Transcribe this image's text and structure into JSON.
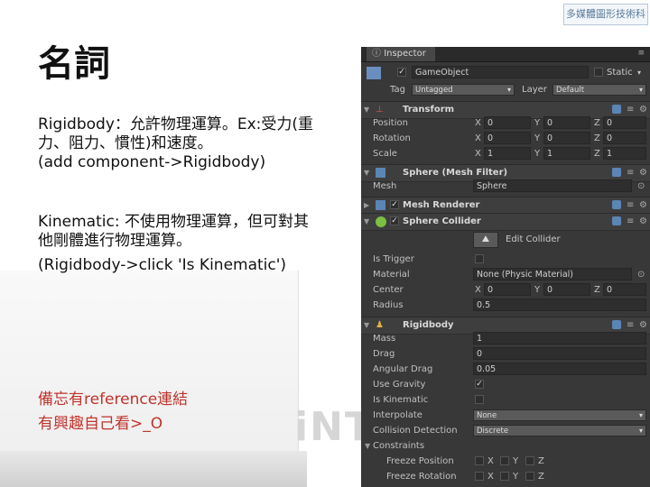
{
  "slide": {
    "title": "名詞",
    "para1_line1": "Rigidbody：允許物理運算。Ex:受力(重",
    "para1_line2": "力、阻力、慣性)和速度。",
    "para1_line3": "(add component->Rigidbody)",
    "para2_line1": "Kinematic: 不使用物理運算，但可對其",
    "para2_line2": "他剛體進行物理運算。",
    "para2_line3": "(Rigidbody->click 'Is Kinematic')",
    "note_line1": "備忘有reference連結",
    "note_line2": "有興趣自己看>_O",
    "logo_text": "多媒體圖形技術科",
    "watermark": "iNT"
  },
  "inspector": {
    "tab_label": "Inspector",
    "gameobject_name": "GameObject",
    "static_label": "Static",
    "tag_label": "Tag",
    "tag_value": "Untagged",
    "layer_label": "Layer",
    "layer_value": "Default",
    "transform": {
      "title": "Transform",
      "position_label": "Position",
      "rotation_label": "Rotation",
      "scale_label": "Scale",
      "x": "X",
      "y": "Y",
      "z": "Z",
      "position": [
        "0",
        "0",
        "0"
      ],
      "rotation": [
        "0",
        "0",
        "0"
      ],
      "scale": [
        "1",
        "1",
        "1"
      ]
    },
    "mesh_filter": {
      "title": "Sphere (Mesh Filter)",
      "mesh_label": "Mesh",
      "mesh_value": "Sphere"
    },
    "mesh_renderer": {
      "title": "Mesh Renderer"
    },
    "sphere_collider": {
      "title": "Sphere Collider",
      "edit_label": "Edit Collider",
      "is_trigger_label": "Is Trigger",
      "material_label": "Material",
      "material_value": "None (Physic Material)",
      "center_label": "Center",
      "center": [
        "0",
        "0",
        "0"
      ],
      "radius_label": "Radius",
      "radius_value": "0.5"
    },
    "rigidbody": {
      "title": "Rigidbody",
      "mass_label": "Mass",
      "mass_value": "1",
      "drag_label": "Drag",
      "drag_value": "0",
      "angular_drag_label": "Angular Drag",
      "angular_drag_value": "0.05",
      "use_gravity_label": "Use Gravity",
      "is_kinematic_label": "Is Kinematic",
      "interpolate_label": "Interpolate",
      "interpolate_value": "None",
      "collision_label": "Collision Detection",
      "collision_value": "Discrete",
      "constraints_label": "Constraints",
      "freeze_position_label": "Freeze Position",
      "freeze_rotation_label": "Freeze Rotation"
    }
  },
  "colors": {
    "note_red": "#c0332b",
    "panel_bg": "#383838",
    "component_blue": "#5b85b5"
  }
}
